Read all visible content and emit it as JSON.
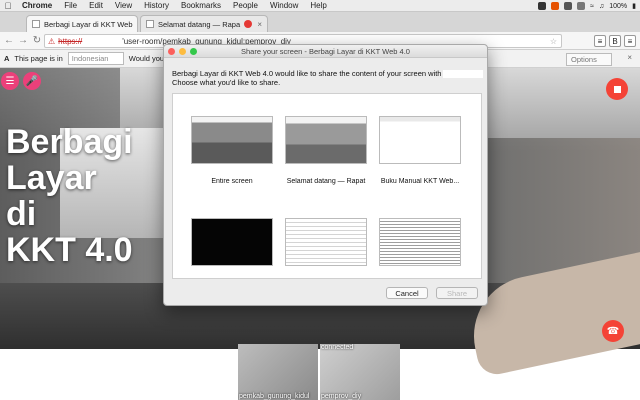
{
  "menubar": {
    "app": "Chrome",
    "items": [
      "File",
      "Edit",
      "View",
      "History",
      "Bookmarks",
      "People",
      "Window",
      "Help"
    ],
    "battery": "100%",
    "battery_icon": "battery-icon"
  },
  "tabs": [
    {
      "title": "Berbagi Layar di KKT Web",
      "close": "×"
    },
    {
      "title": "Selamat datang — Rapa",
      "close": "×"
    }
  ],
  "address": {
    "scheme": "https://",
    "path": "'user-room/pemkab_gunung_kidul:pemprov_diy"
  },
  "translate_bar": {
    "message": "This page is in",
    "language": "Indonesian",
    "question": "Would you like",
    "options": "Options",
    "close": "×"
  },
  "page": {
    "title_lines": [
      "Berbagi",
      "Layar",
      "di",
      "KKT 4.0"
    ]
  },
  "participants": [
    {
      "name": "pemkab_gunung_kidul",
      "status": ""
    },
    {
      "name": "pemprov_diy",
      "status": "connected"
    }
  ],
  "dialog": {
    "title": "Share your screen - Berbagi Layar di KKT Web 4.0",
    "message_line1": "Berbagi Layar di KKT Web 4.0 would like to share the content of your screen with",
    "message_line2": "Choose what you'd like to share.",
    "sources": [
      {
        "label": "Entire screen"
      },
      {
        "label": "Selamat datang — Rapat"
      },
      {
        "label": "Buku Manual KKT Web..."
      },
      {
        "label": ""
      },
      {
        "label": ""
      },
      {
        "label": ""
      }
    ],
    "cancel": "Cancel",
    "share": "Share"
  },
  "colors": {
    "accent_pink": "#ec407a",
    "accent_red": "#f44336"
  }
}
